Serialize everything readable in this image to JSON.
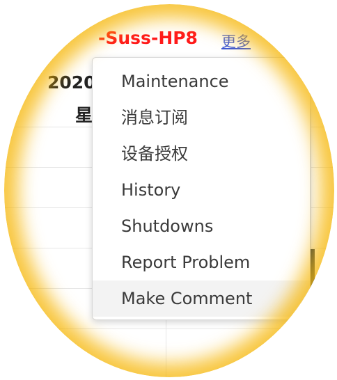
{
  "header": {
    "host_title": "-Suss-HP8",
    "more_link": "更多"
  },
  "calendar": {
    "date_partial": "2020",
    "weekday_partial": "星"
  },
  "menu": {
    "items": [
      {
        "label": "Maintenance"
      },
      {
        "label": "消息订阅"
      },
      {
        "label": "设备授权"
      },
      {
        "label": "History"
      },
      {
        "label": "Shutdowns"
      },
      {
        "label": "Report Problem"
      },
      {
        "label": "Make Comment"
      }
    ],
    "highlighted_item": "Make Comment"
  },
  "colors": {
    "host_title": "#ff1a1a",
    "link": "#3b57d8",
    "lens_rim": "#f5b300",
    "menu_text": "#3a3a3a",
    "menu_highlight": "#f3f3f3"
  }
}
